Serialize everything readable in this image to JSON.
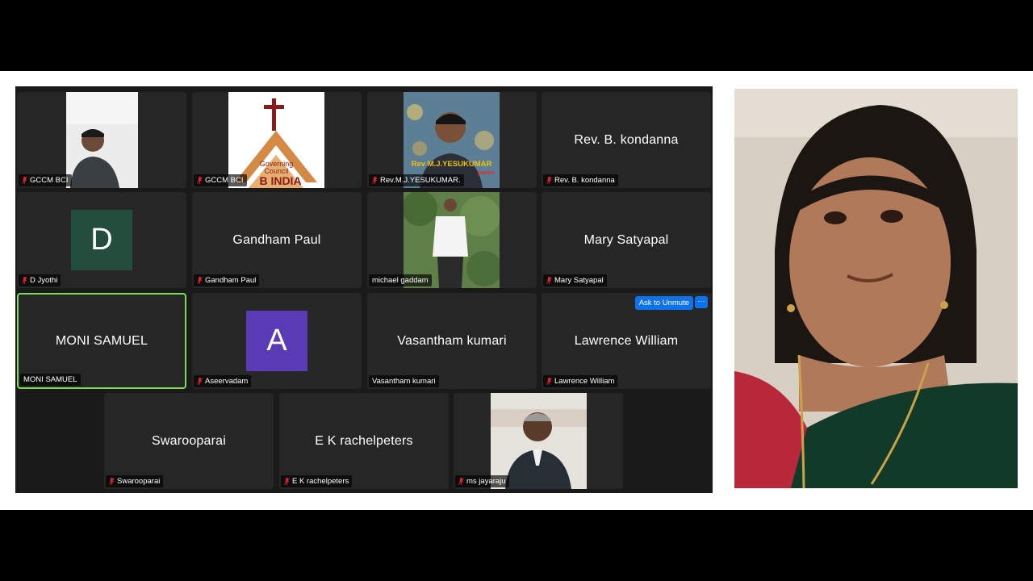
{
  "participants": [
    {
      "id": "p1",
      "name": "GCCM BCI",
      "muted": true,
      "video": "person-cap"
    },
    {
      "id": "p2",
      "name": "GCCM BCI",
      "muted": true,
      "video": "logo",
      "logo_line1": "Governing",
      "logo_line2": "Council",
      "logo_line3": "B INDIA"
    },
    {
      "id": "p3",
      "name": "Rev.M.J.YESUKUMAR.",
      "muted": true,
      "video": "photo",
      "photo_text": "Rev M.J.YESUKUMAR",
      "photo_sub": "pastor"
    },
    {
      "id": "p4",
      "name": "Rev. B. kondanna",
      "muted": true,
      "display": "Rev. B. kondanna"
    },
    {
      "id": "p5",
      "name": "D Jyothi",
      "muted": true,
      "avatar_letter": "D",
      "avatar_color": "#234d3c"
    },
    {
      "id": "p6",
      "name": "Gandham Paul",
      "muted": true,
      "display": "Gandham Paul"
    },
    {
      "id": "p7",
      "name": "michael gaddam",
      "muted": false,
      "video": "outdoor"
    },
    {
      "id": "p8",
      "name": "Mary Satyapal",
      "muted": true,
      "display": "Mary Satyapal"
    },
    {
      "id": "p9",
      "name": "MONI SAMUEL",
      "muted": false,
      "display": "MONI SAMUEL",
      "active": true
    },
    {
      "id": "p10",
      "name": "Aseervadam",
      "muted": true,
      "avatar_letter": "A",
      "avatar_color": "#5b3ab5"
    },
    {
      "id": "p11",
      "name": "Vasantham kumari",
      "muted": false,
      "display": "Vasantham kumari"
    },
    {
      "id": "p12",
      "name": "Lawrence William",
      "muted": true,
      "display": "Lawrence William",
      "ask_label": "Ask to Unmute",
      "more_label": "···"
    },
    {
      "id": "p13",
      "name": "Swarooparai",
      "muted": true,
      "display": "Swarooparai"
    },
    {
      "id": "p14",
      "name": "E K rachelpeters",
      "muted": true,
      "display": "E K rachelpeters"
    },
    {
      "id": "p15",
      "name": "ms jayaraju",
      "muted": true,
      "video": "suit"
    }
  ],
  "colors": {
    "active_border": "#7ed957",
    "button_blue": "#0e72ed",
    "tile_bg": "#262626",
    "mic_muted": "#e0242e"
  }
}
